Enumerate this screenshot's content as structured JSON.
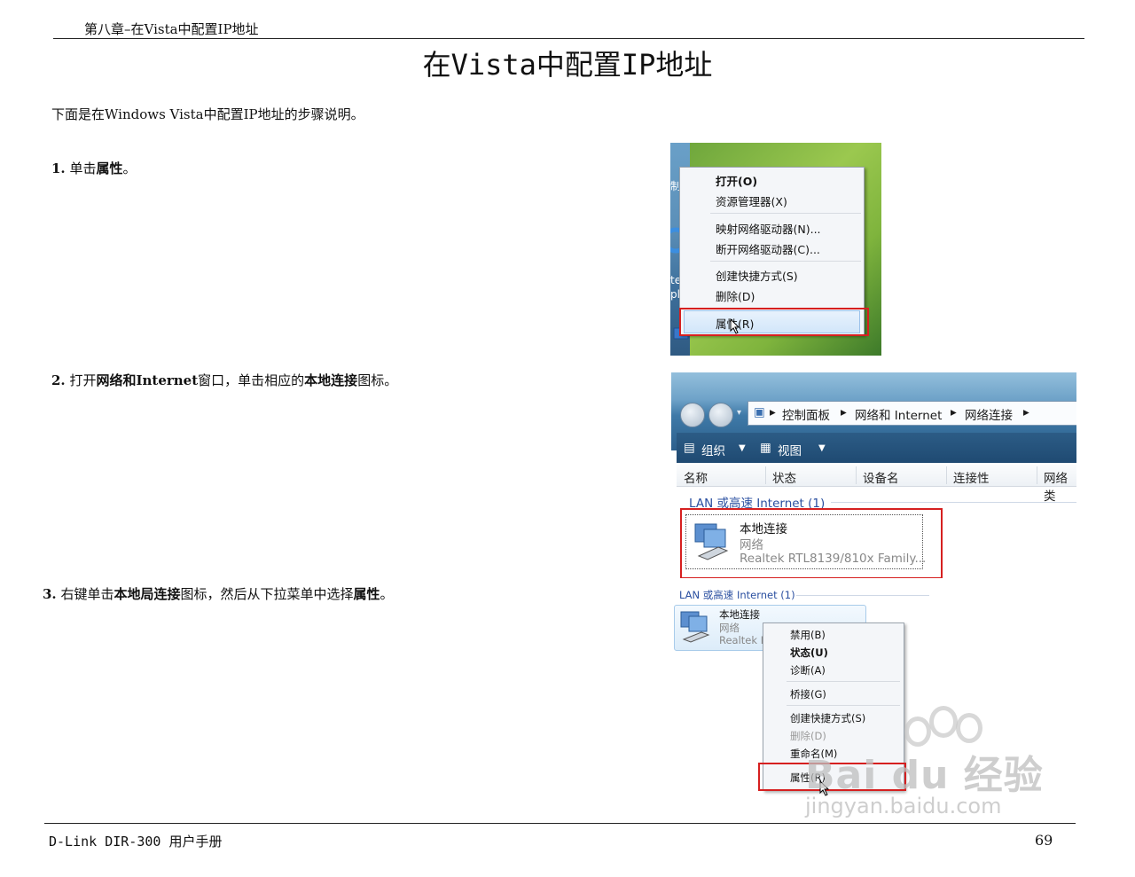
{
  "header": {
    "chapter": "第八章–在Vista中配置IP地址"
  },
  "title": "在Vista中配置IP地址",
  "intro": "下面是在Windows Vista中配置IP地址的步骤说明。",
  "steps": [
    {
      "num": "1.",
      "pre": "单击",
      "bold1": "属性",
      "post": "。"
    },
    {
      "num": "2.",
      "pre": "打开",
      "bold1": "网络和Internet",
      "mid": "窗口，单击相应的",
      "bold2": "本地连接",
      "post": "图标。"
    },
    {
      "num": "3.",
      "pre": "右键单击",
      "bold1": "本地局连接",
      "mid": "图标，然后从下拉菜单中选择",
      "bold2": "属性",
      "post": "。"
    }
  ],
  "shot1": {
    "desktop_labels": [
      "制",
      "te",
      "plo"
    ],
    "menu": [
      "打开(O)",
      "资源管理器(X)",
      "映射网络驱动器(N)...",
      "断开网络驱动器(C)...",
      "创建快捷方式(S)",
      "删除(D)",
      "属性(R)"
    ]
  },
  "shot2": {
    "breadcrumb": [
      "控制面板",
      "网络和 Internet",
      "网络连接"
    ],
    "toolbar": [
      "组织",
      "视图"
    ],
    "columns": [
      "名称",
      "状态",
      "设备名",
      "连接性",
      "网络类"
    ],
    "group": "LAN 或高速 Internet (1)",
    "item": {
      "name": "本地连接",
      "type": "网络",
      "device": "Realtek RTL8139/810x Family..."
    }
  },
  "shot3": {
    "group": "LAN 或高速 Internet (1)",
    "item": {
      "name": "本地连接",
      "type": "网络",
      "device": "Realtek R"
    },
    "menu": [
      "禁用(B)",
      "状态(U)",
      "诊断(A)",
      "桥接(G)",
      "创建快捷方式(S)",
      "删除(D)",
      "重命名(M)",
      "属性(R)"
    ],
    "watermark": "Bai du 经验",
    "watermark_url": "jingyan.baidu.com"
  },
  "footer": {
    "left": "D-Link DIR-300 用户手册",
    "page": "69"
  },
  "colors": {
    "highlight_box": "#d62020",
    "link_blue": "#2a4fa0"
  }
}
